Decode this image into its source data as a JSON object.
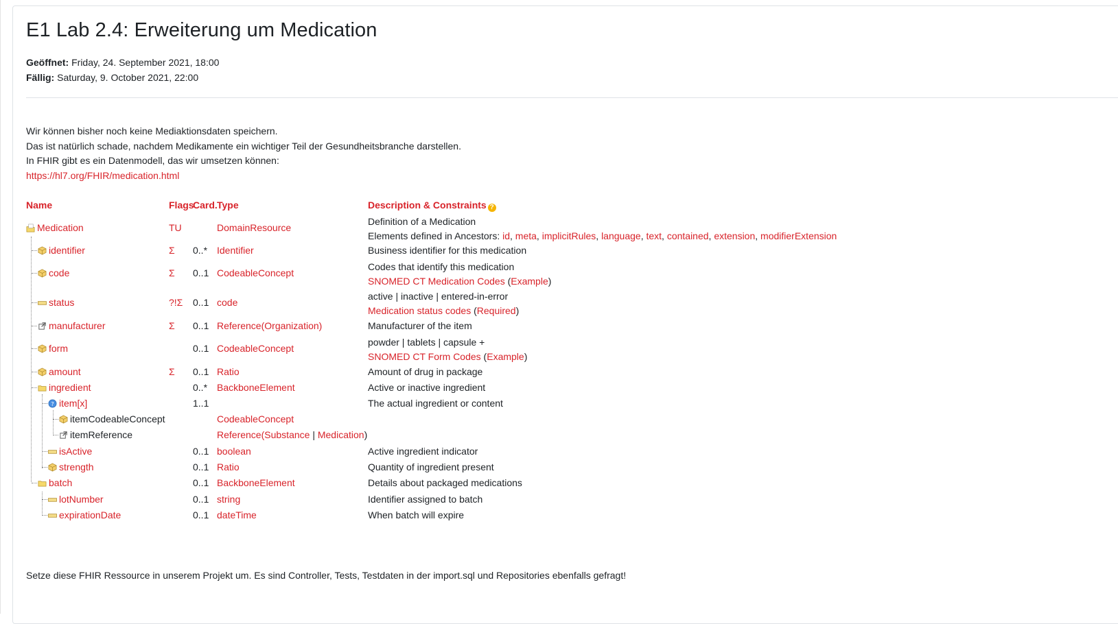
{
  "title": "E1 Lab 2.4: Erweiterung um Medication",
  "dates": {
    "opened_label": "Geöffnet:",
    "opened_value": " Friday, 24. September 2021, 18:00",
    "due_label": "Fällig:",
    "due_value": " Saturday, 9. October 2021, 22:00"
  },
  "intro": {
    "line1": "Wir können bisher noch keine Mediaktionsdaten speichern.",
    "line2": "Das ist natürlich schade, nachdem Medikamente ein wichtiger Teil der Gesundheitsbranche darstellen.",
    "line3": "In FHIR gibt es ein Datenmodell, das wir umsetzen können:",
    "link": "https://hl7.org/FHIR/medication.html"
  },
  "table": {
    "headers": {
      "name": "Name",
      "flags": "Flags",
      "card": "Card.",
      "type": "Type",
      "desc": "Description & Constraints",
      "help_icon": "?"
    },
    "rows": [
      {
        "name": "Medication",
        "flags": "TU",
        "card": "",
        "type": "DomainResource",
        "desc": "Definition of a Medication",
        "desc2_prefix": "Elements defined in Ancestors: ",
        "ancestors": [
          "id",
          "meta",
          "implicitRules",
          "language",
          "text",
          "contained",
          "extension",
          "modifierExtension"
        ],
        "icon": "resource-icon"
      },
      {
        "name": "identifier",
        "flags": "Σ",
        "card": "0..*",
        "type": "Identifier",
        "desc": "Business identifier for this medication",
        "icon": "datatype-icon"
      },
      {
        "name": "code",
        "flags": "Σ",
        "card": "0..1",
        "type": "CodeableConcept",
        "desc": "Codes that identify this medication",
        "binding": "SNOMED CT Medication Codes",
        "strength": "Example",
        "icon": "datatype-icon"
      },
      {
        "name": "status",
        "flags": "?!Σ",
        "card": "0..1",
        "type": "code",
        "desc": "active | inactive | entered-in-error",
        "binding": "Medication status codes",
        "strength": "Required",
        "icon": "primitive-icon"
      },
      {
        "name": "manufacturer",
        "flags": "Σ",
        "card": "0..1",
        "type": "Reference",
        "type_target": "Organization",
        "desc": "Manufacturer of the item",
        "icon": "reference-icon"
      },
      {
        "name": "form",
        "flags": "",
        "card": "0..1",
        "type": "CodeableConcept",
        "desc": "powder | tablets | capsule +",
        "binding": "SNOMED CT Form Codes",
        "strength": "Example",
        "icon": "datatype-icon"
      },
      {
        "name": "amount",
        "flags": "Σ",
        "card": "0..1",
        "type": "Ratio",
        "desc": "Amount of drug in package",
        "icon": "datatype-icon"
      },
      {
        "name": "ingredient",
        "flags": "",
        "card": "0..*",
        "type": "BackboneElement",
        "desc": "Active or inactive ingredient",
        "icon": "element-icon"
      },
      {
        "name": "item[x]",
        "flags": "",
        "card": "1..1",
        "type": "",
        "desc": "The actual ingredient or content",
        "icon": "choice-icon"
      },
      {
        "name": "itemCodeableConcept",
        "flags": "",
        "card": "",
        "type": "CodeableConcept",
        "desc": "",
        "icon": "datatype-icon"
      },
      {
        "name": "itemReference",
        "flags": "",
        "card": "",
        "type": "Reference",
        "type_targets": [
          "Substance",
          "Medication"
        ],
        "desc": "",
        "icon": "reference-icon"
      },
      {
        "name": "isActive",
        "flags": "",
        "card": "0..1",
        "type": "boolean",
        "desc": "Active ingredient indicator",
        "icon": "primitive-icon"
      },
      {
        "name": "strength",
        "flags": "",
        "card": "0..1",
        "type": "Ratio",
        "desc": "Quantity of ingredient present",
        "icon": "datatype-icon"
      },
      {
        "name": "batch",
        "flags": "",
        "card": "0..1",
        "type": "BackboneElement",
        "desc": "Details about packaged medications",
        "icon": "element-icon"
      },
      {
        "name": "lotNumber",
        "flags": "",
        "card": "0..1",
        "type": "string",
        "desc": "Identifier assigned to batch",
        "icon": "primitive-icon"
      },
      {
        "name": "expirationDate",
        "flags": "",
        "card": "0..1",
        "type": "dateTime",
        "desc": "When batch will expire",
        "icon": "primitive-icon"
      }
    ]
  },
  "footer": "Setze diese FHIR Ressource in unserem Projekt um. Es sind Controller, Tests, Testdaten in der import.sql und Repositories ebenfalls gefragt!",
  "colors": {
    "link": "#d8232a",
    "text": "#1d2125"
  }
}
